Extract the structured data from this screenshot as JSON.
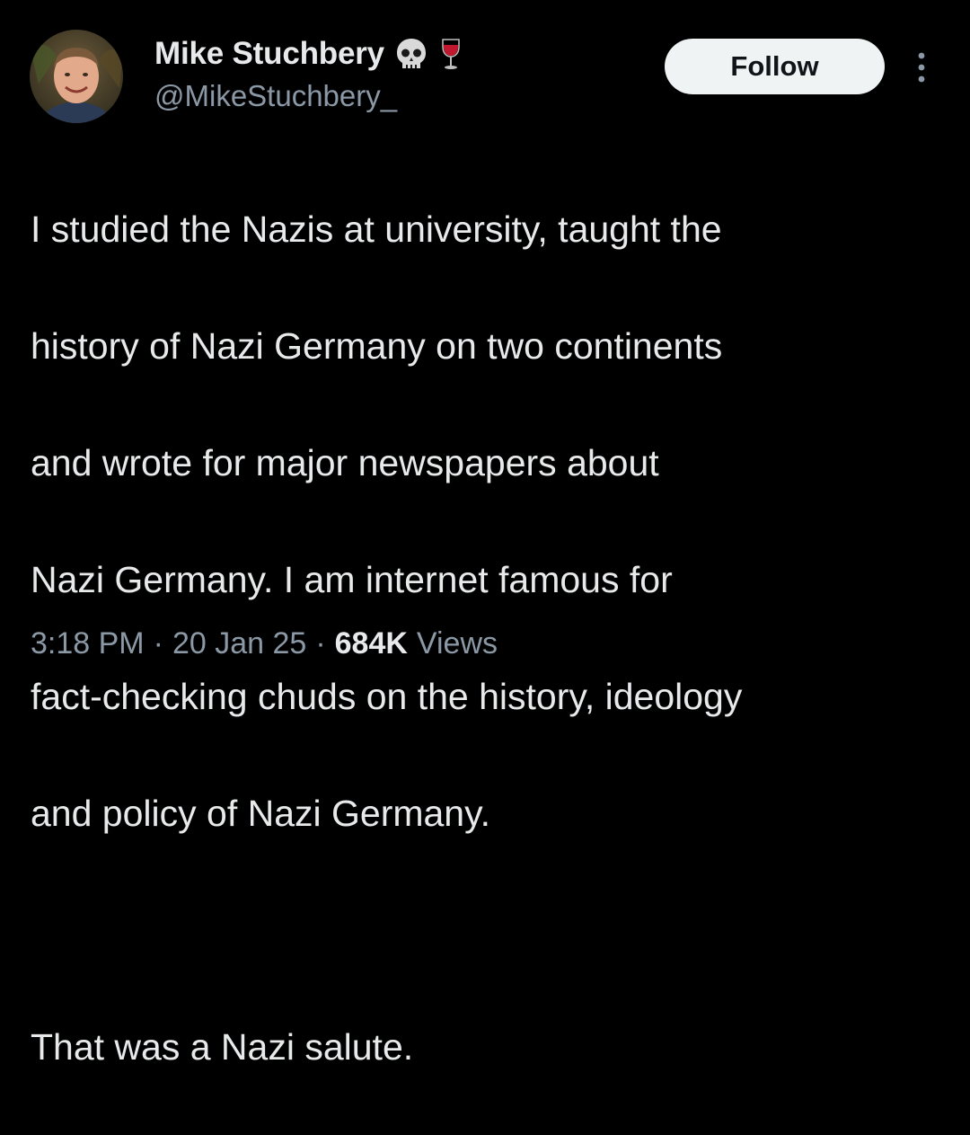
{
  "author": {
    "display_name": "Mike Stuchbery",
    "name_emojis": [
      "skull-icon",
      "wine-glass-icon"
    ],
    "handle": "@MikeStuchbery_"
  },
  "actions": {
    "follow_label": "Follow",
    "more_icon": "more-vertical-icon"
  },
  "tweet": {
    "lines": [
      "I studied the Nazis at university, taught the",
      "history of Nazi Germany on two continents",
      "and wrote for major newspapers about",
      "Nazi Germany. I am internet famous for",
      "fact-checking chuds on the history, ideology",
      "and policy of Nazi Germany."
    ],
    "closing_line": "That was a Nazi salute."
  },
  "meta": {
    "time": "3:18 PM",
    "separator": "·",
    "date": "20 Jan 25",
    "views_count": "684K",
    "views_label": "Views"
  },
  "colors": {
    "background": "#000000",
    "primary_text": "#e7e9ea",
    "secondary_text": "#8b98a5",
    "follow_bg": "#eff3f4",
    "follow_text": "#0f1419"
  }
}
